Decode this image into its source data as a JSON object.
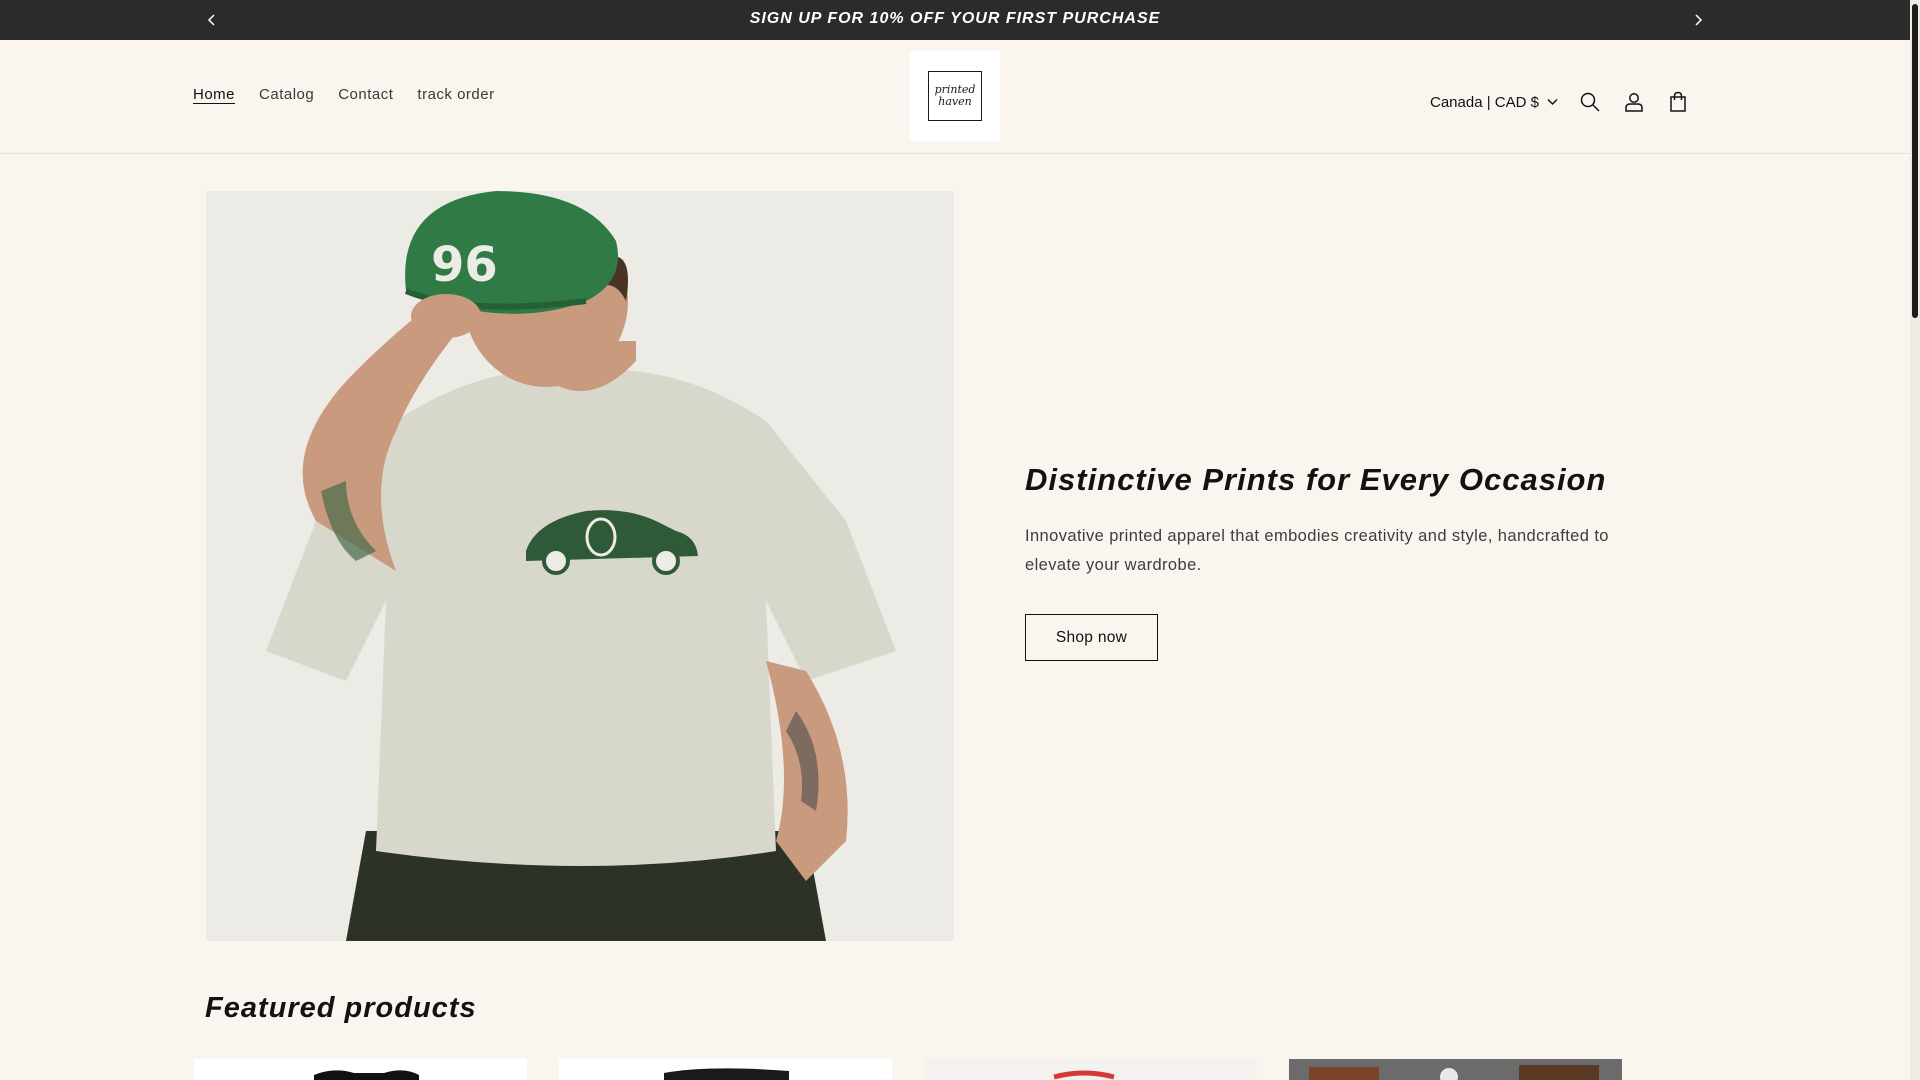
{
  "announcement": {
    "message": "SIGN UP FOR 10% OFF YOUR FIRST PURCHASE"
  },
  "header": {
    "nav": [
      "Home",
      "Catalog",
      "Contact",
      "track order"
    ],
    "logo_lines": [
      "printed",
      "haven"
    ],
    "currency": "Canada | CAD $"
  },
  "hero": {
    "title": "Distinctive Prints for Every Occasion",
    "subtitle": "Innovative printed apparel that embodies creativity and style, handcrafted to elevate your wardrobe.",
    "button": "Shop now",
    "cap_number": "96"
  },
  "featured": {
    "title": "Featured products"
  },
  "colors": {
    "announcement_bg": "#2b2b2b",
    "page_bg": "#faf6ef",
    "cap_green": "#2f7a45",
    "shirt": "#d8d7cb"
  }
}
